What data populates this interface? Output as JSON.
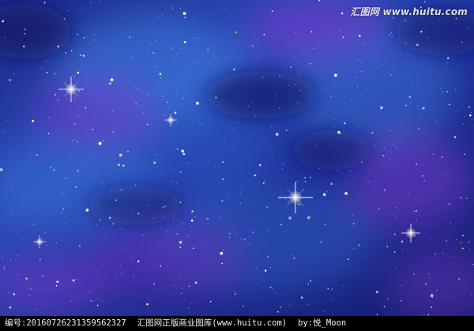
{
  "image": {
    "subject": "starry-night-nebula-sky",
    "colors": {
      "deep_blue": "#121a66",
      "mid_blue": "#2a4fc0",
      "bright_blue": "#4f8fe0",
      "purple": "#6a2ab8",
      "magenta": "#8a3ad8",
      "star": "#ffffff",
      "warm_star": "#ffe9a8"
    }
  },
  "watermark": {
    "text": "汇图网 www.huitu.com"
  },
  "footer": {
    "id_text": "编号:20160726231359562327",
    "site_text": "汇图网正版商业图库(www.huitu.com)",
    "author_text": "by:悦_Moon"
  }
}
